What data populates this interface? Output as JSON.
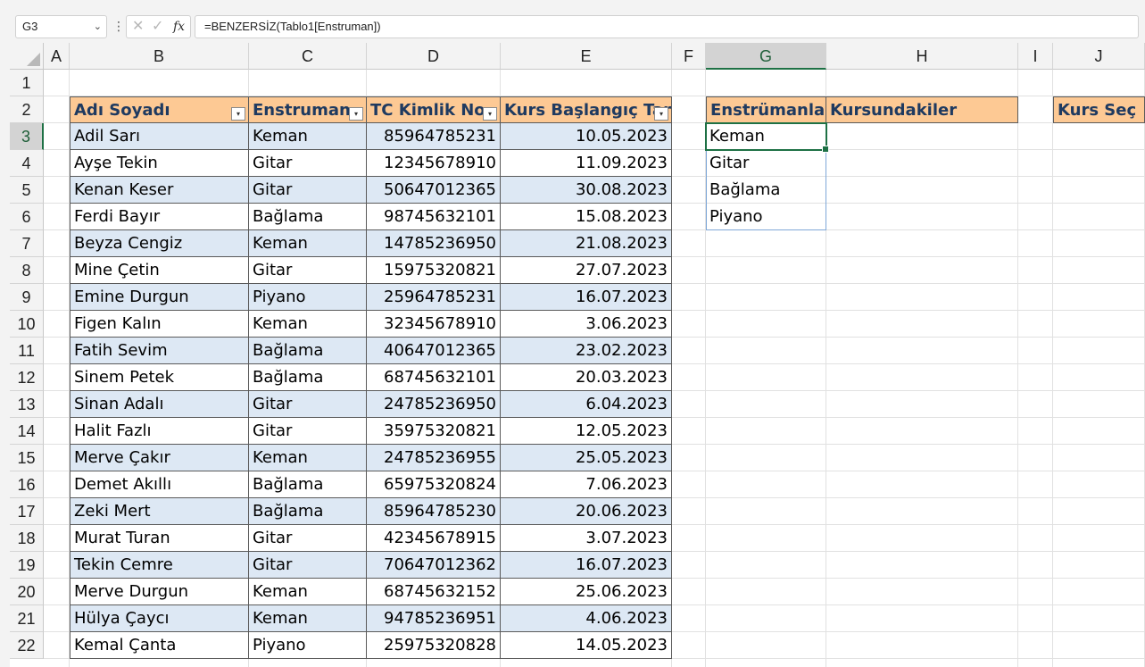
{
  "formula_bar": {
    "name_box": "G3",
    "formula": "=BENZERSİZ(Tablo1[Enstruman])"
  },
  "columns": [
    "A",
    "B",
    "C",
    "D",
    "E",
    "F",
    "G",
    "H",
    "I",
    "J"
  ],
  "rows": [
    "1",
    "2",
    "3",
    "4",
    "5",
    "6",
    "7",
    "8",
    "9",
    "10",
    "11",
    "12",
    "13",
    "14",
    "15",
    "16",
    "17",
    "18",
    "19",
    "20",
    "21",
    "22"
  ],
  "table": {
    "headers": [
      "Adı Soyadı",
      "Enstruman",
      "TC Kimlik No",
      "Kurs Başlangıç Tarihi"
    ],
    "rows": [
      [
        "Adil Sarı",
        "Keman",
        "85964785231",
        "10.05.2023"
      ],
      [
        "Ayşe Tekin",
        "Gitar",
        "12345678910",
        "11.09.2023"
      ],
      [
        "Kenan Keser",
        "Gitar",
        "50647012365",
        "30.08.2023"
      ],
      [
        "Ferdi Bayır",
        "Bağlama",
        "98745632101",
        "15.08.2023"
      ],
      [
        "Beyza Cengiz",
        "Keman",
        "14785236950",
        "21.08.2023"
      ],
      [
        "Mine Çetin",
        "Gitar",
        "15975320821",
        "27.07.2023"
      ],
      [
        "Emine Durgun",
        "Piyano",
        "25964785231",
        "16.07.2023"
      ],
      [
        "Figen Kalın",
        "Keman",
        "32345678910",
        "3.06.2023"
      ],
      [
        "Fatih Sevim",
        "Bağlama",
        "40647012365",
        "23.02.2023"
      ],
      [
        "Sinem Petek",
        "Bağlama",
        "68745632101",
        "20.03.2023"
      ],
      [
        "Sinan Adalı",
        "Gitar",
        "24785236950",
        "6.04.2023"
      ],
      [
        "Halit Fazlı",
        "Gitar",
        "35975320821",
        "12.05.2023"
      ],
      [
        "Merve Çakır",
        "Keman",
        "24785236955",
        "25.05.2023"
      ],
      [
        "Demet Akıllı",
        "Bağlama",
        "65975320824",
        "7.06.2023"
      ],
      [
        "Zeki Mert",
        "Bağlama",
        "85964785230",
        "20.06.2023"
      ],
      [
        "Murat Turan",
        "Gitar",
        "42345678915",
        "3.07.2023"
      ],
      [
        "Tekin Cemre",
        "Gitar",
        "70647012362",
        "16.07.2023"
      ],
      [
        "Merve Durgun",
        "Keman",
        "68745632152",
        "25.06.2023"
      ],
      [
        "Hülya Çaycı",
        "Keman",
        "94785236951",
        "4.06.2023"
      ],
      [
        "Kemal Çanta",
        "Piyano",
        "25975320828",
        "14.05.2023"
      ]
    ]
  },
  "side": {
    "g_header": "Enstrümanlar",
    "h_header": "Kursundakiler",
    "j_header": "Kurs Seç",
    "instruments": [
      "Keman",
      "Gitar",
      "Bağlama",
      "Piyano"
    ]
  },
  "colors": {
    "header_fill": "#fdc994",
    "band_fill": "#dde8f4",
    "header_text": "#1f3a60",
    "selection": "#1e7145"
  }
}
